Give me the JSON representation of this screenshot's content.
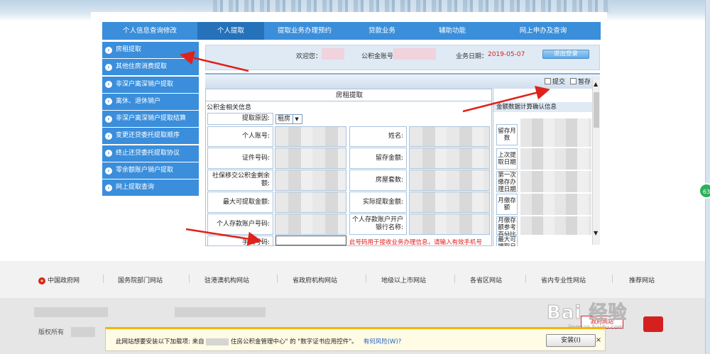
{
  "main_nav": [
    "个人信息查询修改",
    "个人提取",
    "提取业务办理预约",
    "贷款业务",
    "辅助功能",
    "网上申办及查询"
  ],
  "active_nav_index": 1,
  "sidebar": [
    "房租提取",
    "其他住房消费提取",
    "非深户离深销户提取",
    "离休、退休销户",
    "非深户离深销户提取结算",
    "变更还贷委托提取顺序",
    "终止还贷委托提取协议",
    "零余额账户销户提取",
    "网上提取查询"
  ],
  "userbar": {
    "welcome": "欢迎您：",
    "account_label": "公积金账号:",
    "date_label": "业务日期：",
    "date_value": "2019-05-07",
    "logout": "退出登录",
    "accent": "#e01a1a"
  },
  "toolbar": {
    "submit": "提交",
    "save": "暂存"
  },
  "form": {
    "title": "房租提取",
    "section": "公积金相关信息",
    "reason_label": "提取原因:",
    "reason_value": "租房",
    "labels_left": [
      "个人账号:",
      "证件号码:",
      "社保移交公积金剩余额:",
      "最大可提取金额:",
      "个人存款账户号码:",
      "手机号码:"
    ],
    "labels_right": [
      "姓名:",
      "留存金额:",
      "房屋套数:",
      "实际提取金额:",
      "个人存款账户开户银行名称:"
    ],
    "phone_hint": "此号码用于接收业务办理信息，请输入有效手机号"
  },
  "right_panel": {
    "header": "金额数据计算确认信息",
    "labels": [
      "留存月数",
      "上次提取日期",
      "第一次缴存办理日期",
      "月缴存额",
      "月缴存额参考百分比",
      "最大可提取日期"
    ]
  },
  "footer_links": [
    "中国政府网",
    "国务院部门网站",
    "驻港澳机构网站",
    "省政府机构网站",
    "地级以上市网站",
    "各省区网站",
    "省内专业性网站",
    "推荐网站"
  ],
  "copyright": "版权所有",
  "badge_gov": "政府网站",
  "install_bar": {
    "message_prefix": "此网站想要安装以下加载项: 来自",
    "message_mid": "住房公积金管理中心\" 的 \"数字证书应用控件\"。",
    "risk": "有何风险(W)?",
    "install": "安装(I)",
    "close": "×"
  },
  "watermark": "Bai 经验",
  "watermark_sub": "jingyan.baidu.com",
  "bubble": "63",
  "icons": [
    "chevron-right-icon",
    "submit-icon",
    "save-icon",
    "scroll-up-icon",
    "scroll-down-icon",
    "star-icon",
    "close-icon"
  ]
}
